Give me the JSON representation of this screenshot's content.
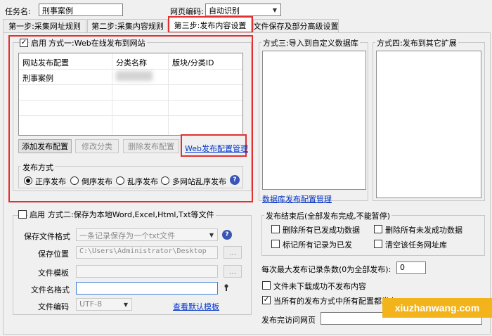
{
  "task": {
    "label": "任务名:",
    "value": "刑事案例"
  },
  "encoding": {
    "label": "网页编码:",
    "value": "自动识别"
  },
  "tabs": [
    {
      "label": "第一步:采集网址规则"
    },
    {
      "label": "第二步:采集内容规则"
    },
    {
      "label": "第三步:发布内容设置"
    },
    {
      "label": "文件保存及部分高级设置"
    }
  ],
  "method1": {
    "checkbox_label": "启用",
    "title": "方式一:Web在线发布到网站",
    "columns": [
      "网站发布配置",
      "分类名称",
      "版块/分类ID"
    ],
    "rows": [
      [
        "刑事案例",
        "",
        ""
      ]
    ],
    "buttons": {
      "add": "添加发布配置",
      "edit": "修改分类",
      "delete": "删除发布配置"
    },
    "manage_link": "Web发布配置管理",
    "publish_mode": {
      "title": "发布方式",
      "options": [
        "正序发布",
        "倒序发布",
        "乱序发布",
        "多网站乱序发布"
      ]
    }
  },
  "method3": {
    "title": "方式三:导入到自定义数据库",
    "link": "数据库发布配置管理"
  },
  "method4": {
    "title": "方式四:发布到其它扩展"
  },
  "method2": {
    "checkbox_label": "启用",
    "title": "方式二:保存为本地Word,Excel,Html,Txt等文件",
    "format_label": "保存文件格式",
    "format_value": "一条记录保存为一个txt文件",
    "location_label": "保存位置",
    "location_value": "C:\\Users\\Administrator\\Desktop",
    "template_label": "文件模板",
    "template_value": "",
    "filename_label": "文件名格式",
    "filename_value": "",
    "fileenc_label": "文件编码",
    "fileenc_value": "UTF-8",
    "browse": "...",
    "default_template_link": "查看默认模板"
  },
  "after_publish": {
    "title": "发布结束后(全部发布完成,不能暂停)",
    "options": [
      "删除所有已发成功数据",
      "删除所有未发成功数据",
      "标记所有记录为已发",
      "清空该任务网址库"
    ]
  },
  "max_records": {
    "label": "每次最大发布记录条数(0为全部发布):",
    "value": "0"
  },
  "skip_failed": {
    "label": "文件未下载成功不发布内容"
  },
  "all_methods": {
    "label": "当所有的发布方式中所有配置都发布"
  },
  "visit_after": {
    "label": "发布完访问网页"
  },
  "watermark": {
    "text": "xiuzhanwang.com"
  },
  "colors": {
    "highlight": "#e03030",
    "link": "#0033cc",
    "watermark_bg": "#f3b31a"
  },
  "icons": {
    "help": "question-mark-icon",
    "dropdown": "chevron-down-icon",
    "variable": "variable-marker-icon"
  }
}
